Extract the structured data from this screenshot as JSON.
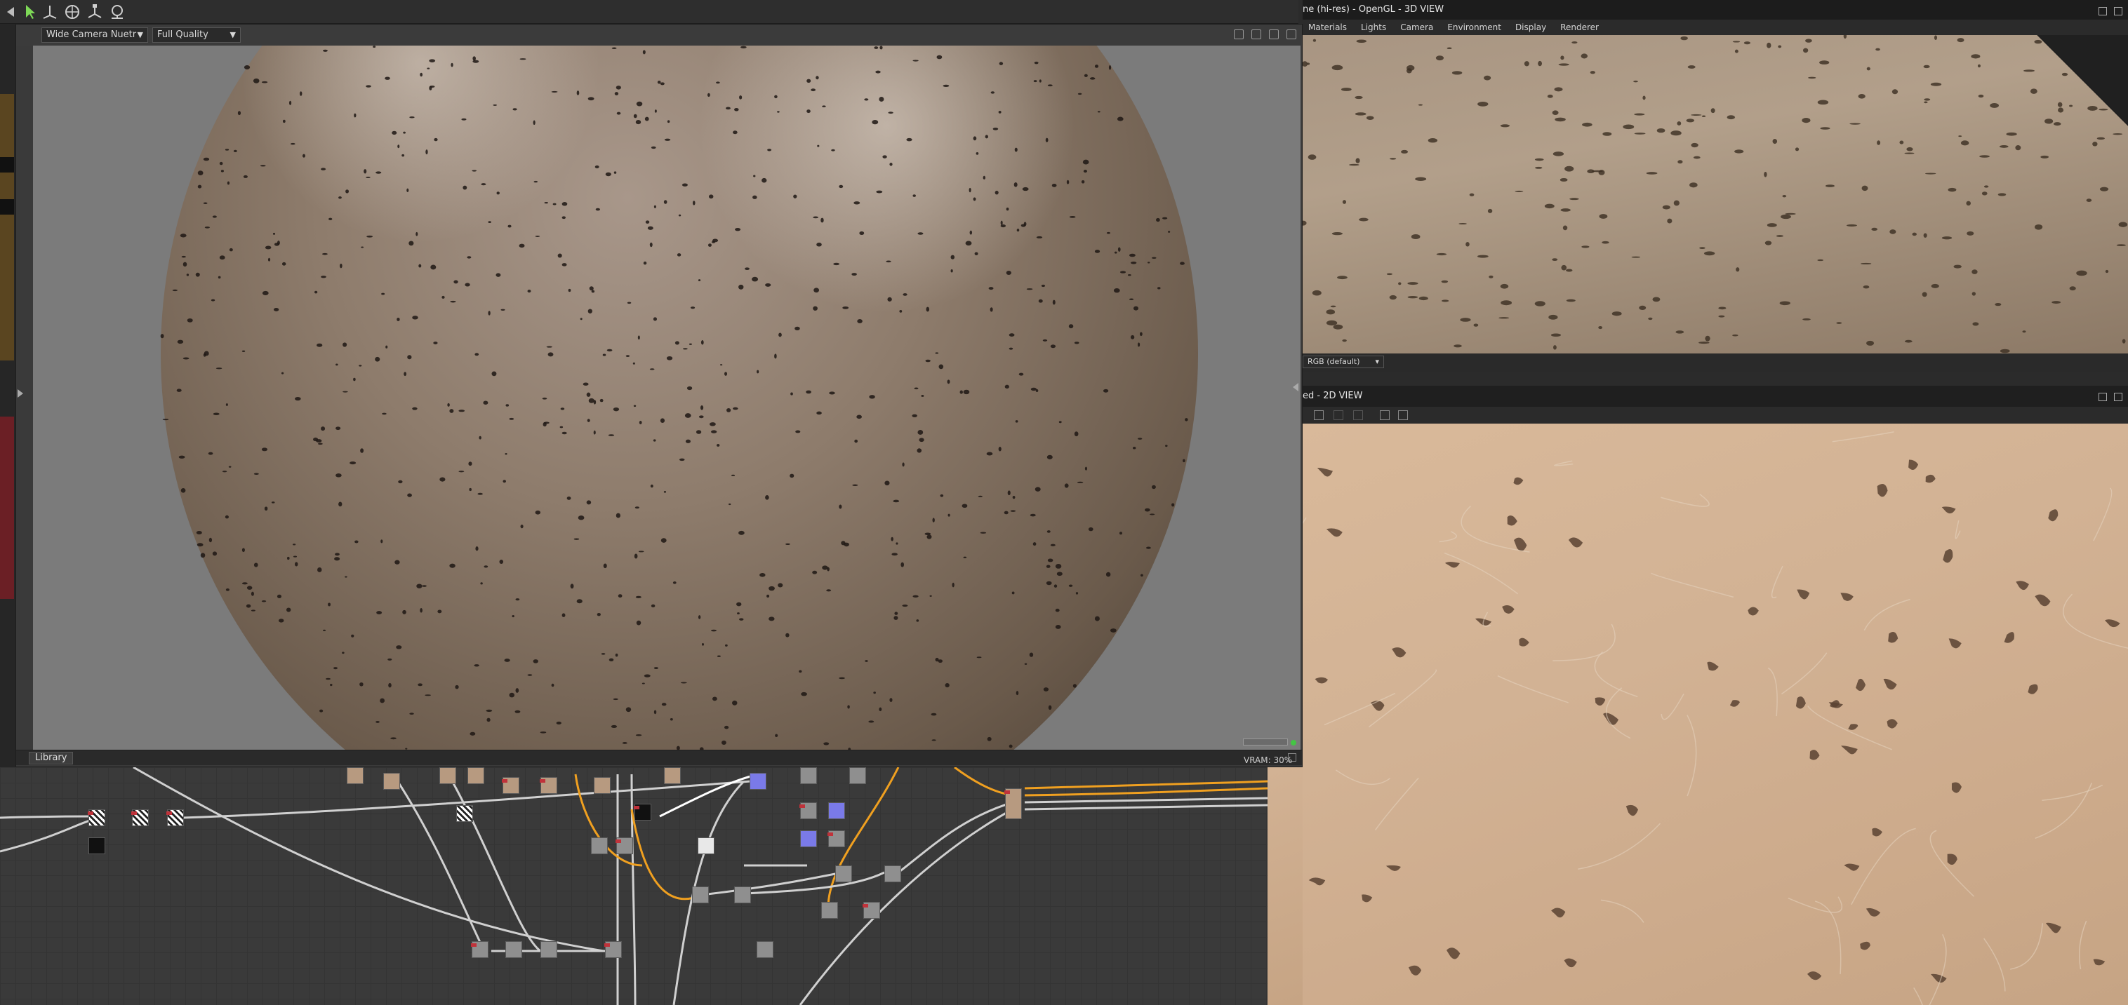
{
  "renderer": {
    "camera_dropdown": "Wide Camera Nuetr",
    "quality_dropdown": "Full Quality",
    "library_tab": "Library",
    "vram": "VRAM: 30%"
  },
  "view3d": {
    "title": "ne (hi-res) - OpenGL - 3D VIEW",
    "menu": [
      "Materials",
      "Lights",
      "Camera",
      "Environment",
      "Display",
      "Renderer"
    ],
    "color_space_dropdown": "RGB (default)"
  },
  "view2d": {
    "title": "ed - 2D VIEW"
  },
  "colors": {
    "node_blue": "#7a7ae8",
    "connection_orange": "#f0a020",
    "status_green": "#45c545"
  }
}
